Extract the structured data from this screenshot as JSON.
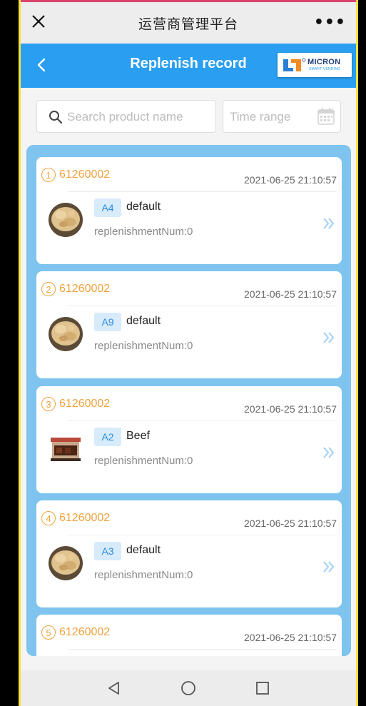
{
  "wechat_bar": {
    "title": "运营商管理平台",
    "more": "•••"
  },
  "header": {
    "title": "Replenish record",
    "logo_brand": "MICRON",
    "logo_sub": "SMART VENDING"
  },
  "search": {
    "placeholder": "Search product name",
    "value": ""
  },
  "time_range": {
    "placeholder": "Time range",
    "value": ""
  },
  "records": [
    {
      "index": "1",
      "machine": "61260002",
      "time": "2021-06-25 21:10:57",
      "slot": "A4",
      "product": "default",
      "replenish": "replenishmentNum:0",
      "image": "ginger"
    },
    {
      "index": "2",
      "machine": "61260002",
      "time": "2021-06-25 21:10:57",
      "slot": "A9",
      "product": "default",
      "replenish": "replenishmentNum:0",
      "image": "ginger"
    },
    {
      "index": "3",
      "machine": "61260002",
      "time": "2021-06-25 21:10:57",
      "slot": "A2",
      "product": "Beef",
      "replenish": "replenishmentNum:0",
      "image": "beef"
    },
    {
      "index": "4",
      "machine": "61260002",
      "time": "2021-06-25 21:10:57",
      "slot": "A3",
      "product": "default",
      "replenish": "replenishmentNum:0",
      "image": "ginger"
    },
    {
      "index": "5",
      "machine": "61260002",
      "time": "2021-06-25 21:10:57"
    }
  ],
  "colors": {
    "header_blue": "#2a9ff1",
    "panel_blue": "#7ec4ee",
    "accent_orange": "#f0a23c",
    "slot_bg": "#d8ebfb"
  }
}
